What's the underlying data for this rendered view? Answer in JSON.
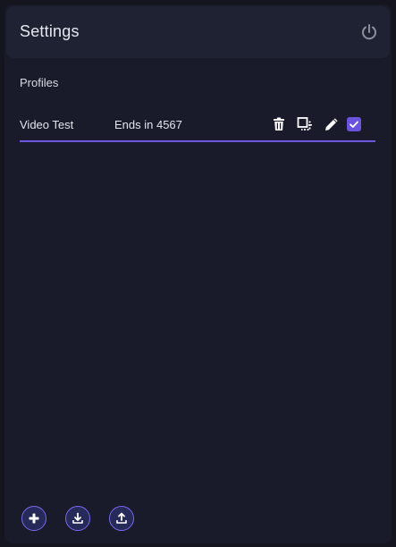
{
  "header": {
    "title": "Settings",
    "power_icon": "power-icon"
  },
  "profiles": {
    "section_label": "Profiles",
    "items": [
      {
        "name": "Video Test",
        "card": "Ends in 4567",
        "selected": true,
        "actions": [
          "trash-icon",
          "duplicate-icon",
          "pencil-icon",
          "checkbox"
        ]
      }
    ]
  },
  "footer": {
    "buttons": [
      "add-icon",
      "import-icon",
      "export-icon"
    ]
  },
  "colors": {
    "accent": "#6c57e0",
    "panel": "#191b2a",
    "header": "#1e2233"
  }
}
